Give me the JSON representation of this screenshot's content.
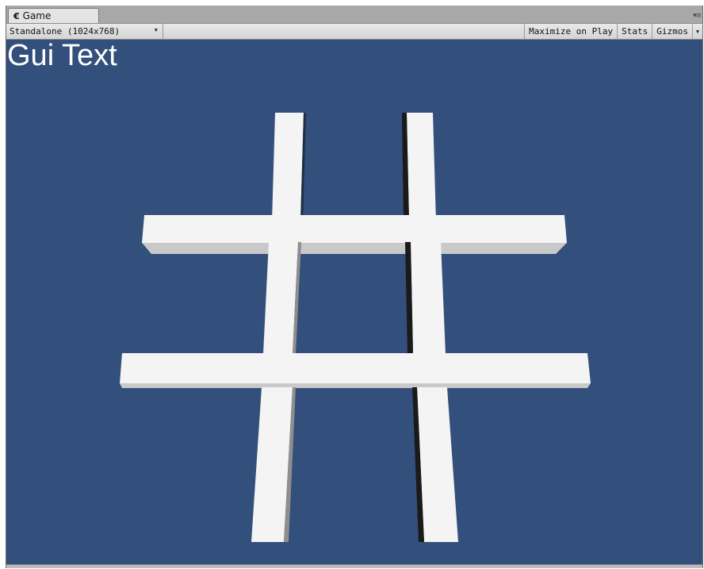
{
  "tab": {
    "icon": "game-icon",
    "label": "Game"
  },
  "toolbar": {
    "aspect_selected": "Standalone (1024x768)",
    "maximize_label": "Maximize on Play",
    "stats_label": "Stats",
    "gizmos_label": "Gizmos"
  },
  "viewport": {
    "gui_text": "Gui Text",
    "background_color": "#334f7b",
    "bar_color": "#f4f4f4"
  }
}
